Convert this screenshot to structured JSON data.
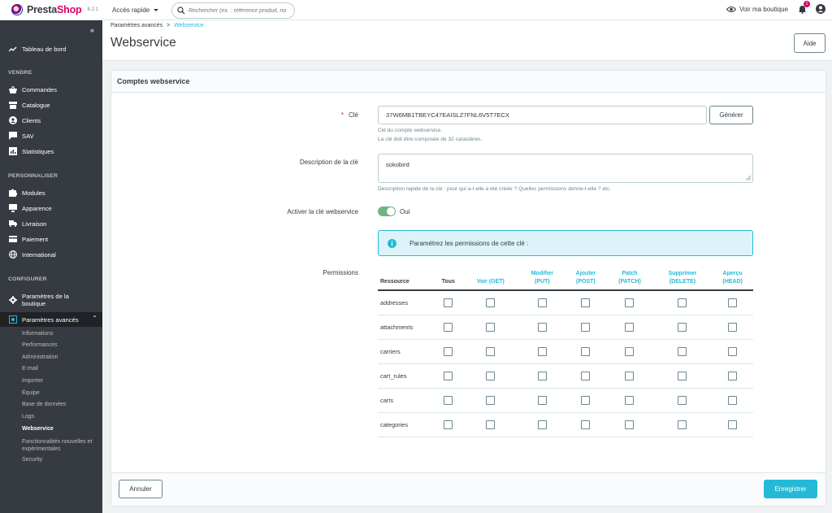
{
  "topbar": {
    "brand_a": "Presta",
    "brand_b": "Shop",
    "version": "8.2.1",
    "quick_access": "Accès rapide",
    "search_placeholder": "Rechercher (ex. : référence produit, no",
    "view_shop": "Voir ma boutique",
    "notif_count": "1",
    "accent_color": "#25b9d7",
    "brand_color": "#df0067"
  },
  "sidebar": {
    "dashboard": "Tableau de bord",
    "sections": [
      "VENDRE",
      "PERSONNALISER",
      "CONFIGURER"
    ],
    "sell": [
      "Commandes",
      "Catalogue",
      "Clients",
      "SAV",
      "Statistiques"
    ],
    "customize": [
      "Modules",
      "Apparence",
      "Livraison",
      "Paiement",
      "International"
    ],
    "configure": [
      "Paramètres de la boutique",
      "Paramètres avancés"
    ],
    "advanced_sub": [
      "Informations",
      "Performances",
      "Administration",
      "E-mail",
      "Importer",
      "Équipe",
      "Base de données",
      "Logs",
      "Webservice",
      "Fonctionnalités nouvelles et expérimentales",
      "Security"
    ]
  },
  "header": {
    "breadcrumb_parent": "Paramètres avancés",
    "breadcrumb_sep": ">",
    "breadcrumb_current": "Webservice",
    "title": "Webservice",
    "help_label": "Aide"
  },
  "form": {
    "card_title": "Comptes webservice",
    "key_label": "Clé",
    "key_required": "*",
    "key_value": "37W6MB1TBEYC47EAISLZ7FNL6V5T7ECX",
    "generate_label": "Générer",
    "key_help_1": "Clé du compte webservice.",
    "key_help_2": "La clé doit être composée de 32 caractères.",
    "desc_label": "Description de la clé",
    "desc_value": "sokobird",
    "desc_help": "Description rapide de la clé : pour qui a-t-elle a été créée ? Quelles permissions donne-t-elle ? etc.",
    "active_label": "Activer la clé webservice",
    "active_value": "Oui",
    "alert_text": "Paramétrez les permissions de cette clé :",
    "permissions_label": "Permissions",
    "cancel_label": "Annuler",
    "save_label": "Enregistrer"
  },
  "permissions": {
    "headers": {
      "resource": "Ressource",
      "all": "Tous",
      "get_1": "Voir (GET)",
      "put_1": "Modifier",
      "put_2": "(PUT)",
      "post_1": "Ajouter",
      "post_2": "(POST)",
      "patch_1": "Patch",
      "patch_2": "(PATCH)",
      "delete_1": "Supprimer",
      "delete_2": "(DELETE)",
      "head_1": "Aperçu",
      "head_2": "(HEAD)"
    },
    "rows": [
      "addresses",
      "attachments",
      "carriers",
      "cart_rules",
      "carts",
      "categories"
    ]
  }
}
